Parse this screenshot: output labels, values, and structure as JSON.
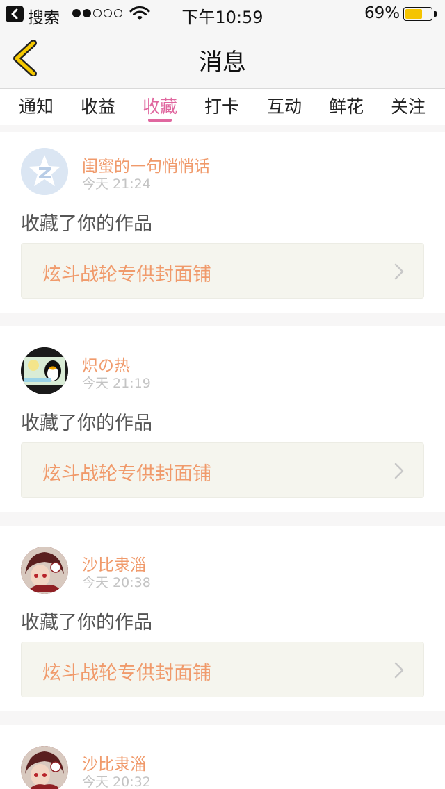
{
  "status_bar": {
    "back_label": "搜索",
    "time": "下午10:59",
    "battery_text": "69%",
    "battery_level": 0.69,
    "signal_bars_filled": 2,
    "signal_bars_total": 5
  },
  "nav": {
    "title": "消息",
    "back_icon": "chevron-left-icon"
  },
  "tabs": [
    {
      "label": "通知"
    },
    {
      "label": "收益"
    },
    {
      "label": "收藏",
      "active": true
    },
    {
      "label": "打卡"
    },
    {
      "label": "互动"
    },
    {
      "label": "鲜花"
    },
    {
      "label": "关注"
    }
  ],
  "messages": [
    {
      "user": "闺蜜的一句悄悄话",
      "time": "今天 21:24",
      "action": "收藏了你的作品",
      "work": "炫斗战轮专供封面铺",
      "avatar": "qzone-logo-avatar"
    },
    {
      "user": "炽の热",
      "time": "今天 21:19",
      "action": "收藏了你的作品",
      "work": "炫斗战轮专供封面铺",
      "avatar": "qq-penguin-avatar"
    },
    {
      "user": "沙比隶淄",
      "time": "今天 20:38",
      "action": "收藏了你的作品",
      "work": "炫斗战轮专供封面铺",
      "avatar": "anime-character-avatar"
    },
    {
      "user": "沙比隶淄",
      "time": "今天 20:32",
      "avatar": "anime-character-avatar"
    }
  ],
  "colors": {
    "accent": "#e0679f",
    "username": "#f09a6b",
    "back_chevron": "#f5c800",
    "battery": "#f5c400"
  }
}
